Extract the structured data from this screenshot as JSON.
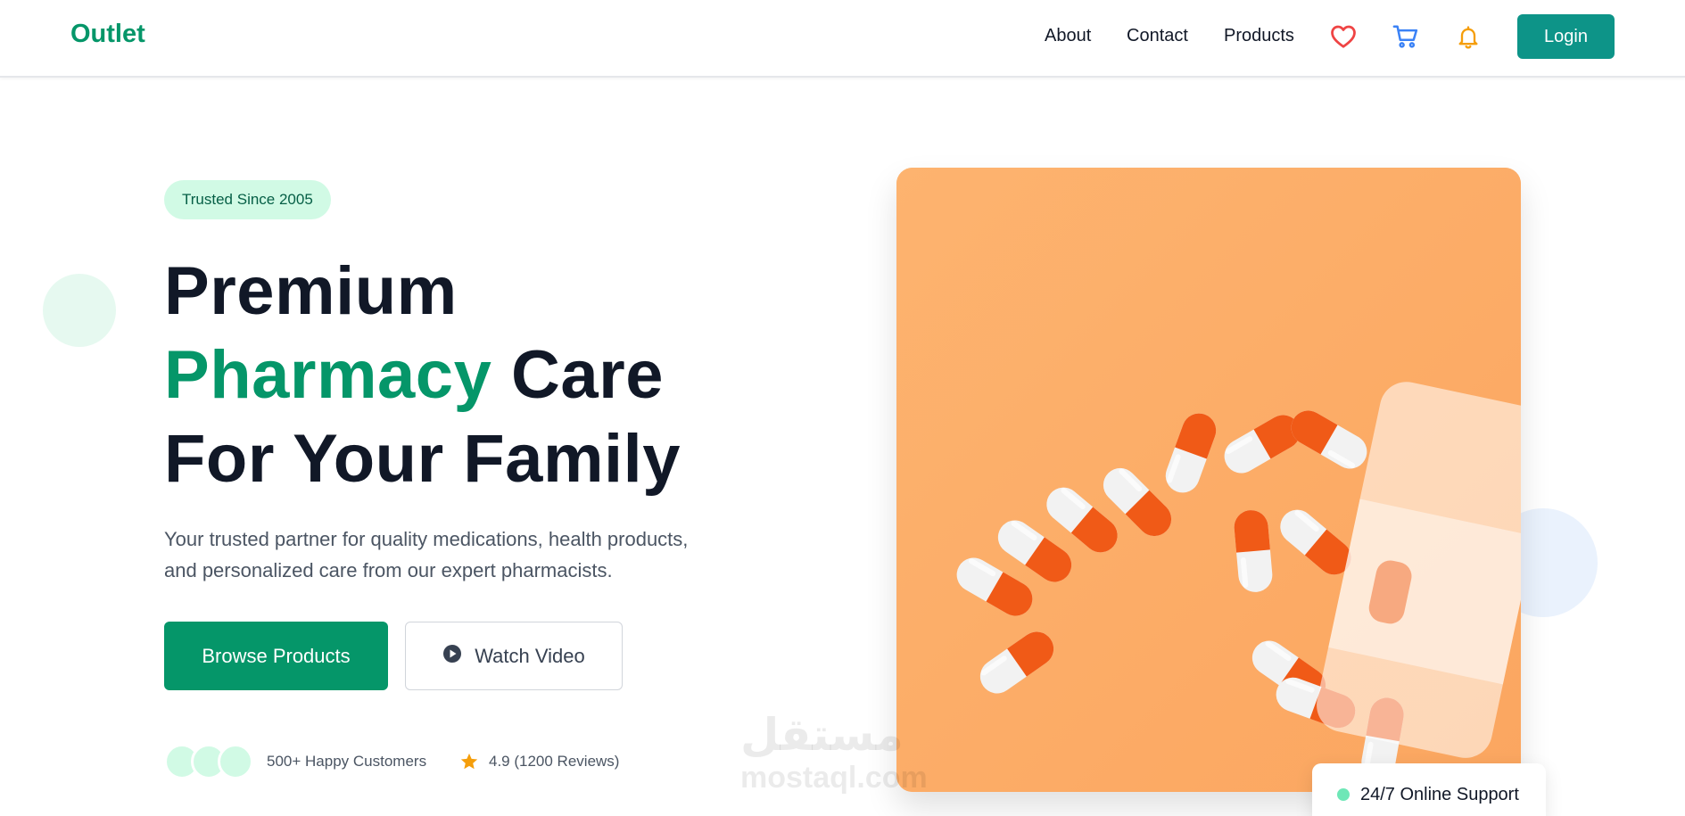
{
  "header": {
    "brand": "Outlet",
    "nav": {
      "about": "About",
      "contact": "Contact",
      "products": "Products"
    },
    "icons": [
      "heart-icon",
      "cart-icon",
      "bell-icon"
    ],
    "login_label": "Login"
  },
  "hero": {
    "badge": "Trusted Since 2005",
    "title_line1": "Premium",
    "title_accent": "Pharmacy",
    "title_line2_rest": " Care",
    "title_line3": "For Your Family",
    "description_line1": "Your trusted partner for quality medications, health products,",
    "description_line2": "and personalized care from our expert pharmacists.",
    "primary_button": "Browse Products",
    "secondary_button": "Watch Video",
    "customers_stat": "500+ Happy Customers",
    "rating_stat": "4.9 (1200 Reviews)"
  },
  "image": {
    "subject": "orange and white capsules spilling from a pill bottle"
  },
  "support": {
    "label": "24/7 Online Support"
  },
  "watermark": {
    "arabic": "مستقل",
    "latin": "mostaql.com"
  },
  "colors": {
    "brand_green": "#059669",
    "login_teal": "#0d9488",
    "heart_red": "#ef4444",
    "cart_blue": "#3b82f6",
    "bell_amber": "#f59e0b",
    "image_bg": "#fcaf69"
  }
}
